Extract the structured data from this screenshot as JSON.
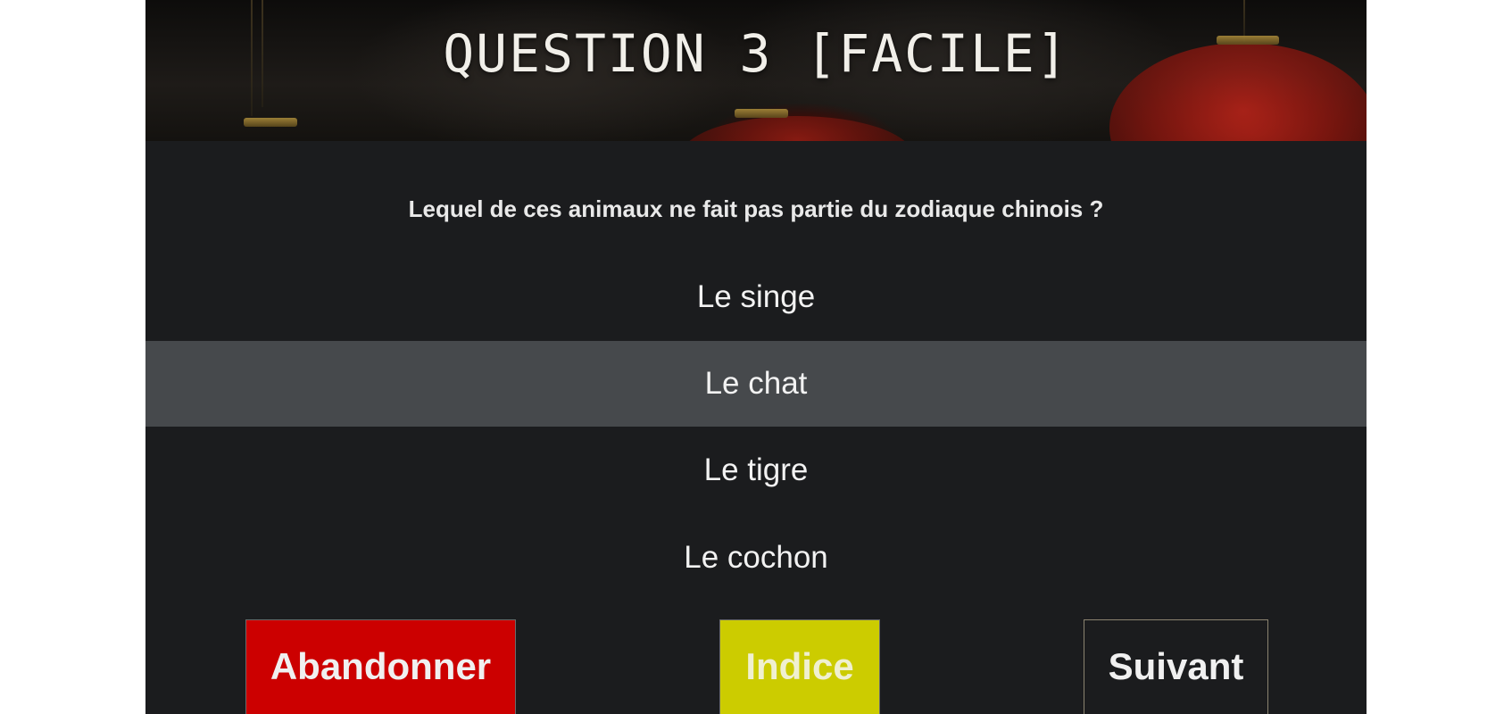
{
  "header": {
    "title": "QUESTION 3 [FACILE]"
  },
  "question": {
    "text": "Lequel de ces animaux ne fait pas partie du zodiaque chinois ?"
  },
  "answers": [
    {
      "label": "Le singe",
      "selected": false
    },
    {
      "label": "Le chat",
      "selected": true
    },
    {
      "label": "Le tigre",
      "selected": false
    },
    {
      "label": "Le cochon",
      "selected": false
    }
  ],
  "buttons": {
    "abandon_label": "Abandonner",
    "hint_label": "Indice",
    "next_label": "Suivant"
  },
  "colors": {
    "abandon": "#cc0000",
    "hint": "#cccc00",
    "panel": "#1b1c1e",
    "selected_row": "#46494c"
  }
}
